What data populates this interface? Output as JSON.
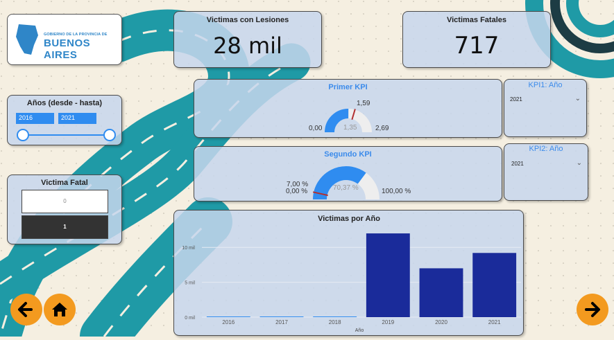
{
  "logo": {
    "line1": "GOBIERNO DE LA PROVINCIA DE",
    "line2": "BUENOS AIRES"
  },
  "years_slicer": {
    "title": "Años (desde - hasta)",
    "from": "2016",
    "to": "2021"
  },
  "fatal_slicer": {
    "title": "Victima Fatal",
    "options": [
      "0",
      "1"
    ],
    "selected": "1"
  },
  "cards": {
    "lesiones": {
      "title": "Victimas con Lesiones",
      "value": "28 mil"
    },
    "fatales": {
      "title": "Victimas Fatales",
      "value": "717"
    }
  },
  "kpi1": {
    "title": "Primer KPI",
    "min": "0,00",
    "max": "2,69",
    "target": "1,59",
    "value": "1,35",
    "value_num": 1.35,
    "max_num": 2.69,
    "target_num": 1.59
  },
  "kpi2": {
    "title": "Segundo KPI",
    "min": "0,00 %",
    "max": "100,00 %",
    "target": "7,00 %",
    "value": "70,37 %",
    "value_num": 70.37,
    "max_num": 100,
    "target_num": 7
  },
  "kpi1_year": {
    "title": "KPI1: Año",
    "selected": "2021"
  },
  "kpi2_year": {
    "title": "KPI2: Año",
    "selected": "2021"
  },
  "chart_data": {
    "type": "bar",
    "title": "Victimas por Año",
    "xlabel": "Año",
    "ylabel": "",
    "categories": [
      "2016",
      "2017",
      "2018",
      "2019",
      "2020",
      "2021"
    ],
    "values": [
      0,
      0,
      0,
      12000,
      7000,
      9200
    ],
    "yticks": [
      {
        "v": 0,
        "label": "0 mil"
      },
      {
        "v": 5000,
        "label": "5 mil"
      },
      {
        "v": 10000,
        "label": "10 mil"
      }
    ],
    "ylim": [
      0,
      12800
    ],
    "color": "#1a2b9a"
  },
  "colors": {
    "accent": "#2f8cf0",
    "nav": "#f39a1f",
    "road": "#1f9aa6"
  },
  "icons": {
    "back": "arrow-left-icon",
    "home": "home-icon",
    "next": "arrow-right-icon"
  }
}
